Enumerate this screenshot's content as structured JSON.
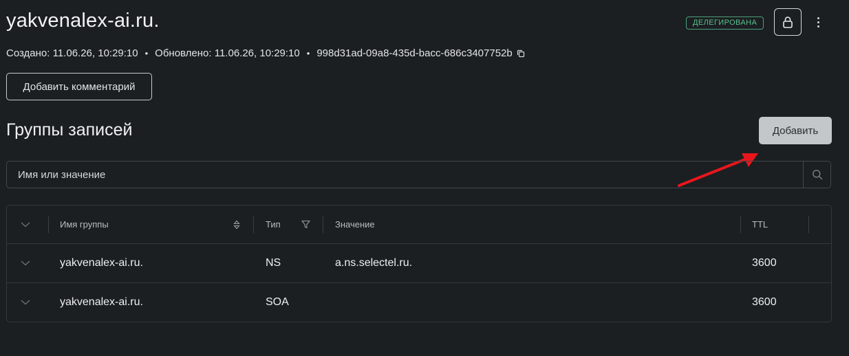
{
  "header": {
    "title": "yakvenalex-ai.ru.",
    "status_badge": "ДЕЛЕГИРОВАНА",
    "lock_icon": "lock-icon",
    "menu_icon": "kebab-icon"
  },
  "meta": {
    "created": "Создано: 11.06.26, 10:29:10",
    "separator": "•",
    "updated": "Обновлено: 11.06.26, 10:29:10",
    "id": "998d31ad-09a8-435d-bacc-686c3407752b",
    "copy_icon": "copy-icon"
  },
  "comment_button": "Добавить комментарий",
  "section": {
    "title": "Группы записей",
    "add_button": "Добавить"
  },
  "search": {
    "placeholder": "Имя или значение",
    "icon": "search-icon"
  },
  "table": {
    "columns": [
      "Имя группы",
      "Тип",
      "Значение",
      "TTL"
    ],
    "rows": [
      {
        "name": "yakvenalex-ai.ru.",
        "type": "NS",
        "value": "a.ns.selectel.ru.",
        "ttl": "3600"
      },
      {
        "name": "yakvenalex-ai.ru.",
        "type": "SOA",
        "value": "",
        "ttl": "3600"
      }
    ]
  },
  "colors": {
    "background": "#1b1f22",
    "badge": "#5cc08f",
    "add_button_bg": "#c4c7ca",
    "annotation_arrow": "#e8161c"
  }
}
